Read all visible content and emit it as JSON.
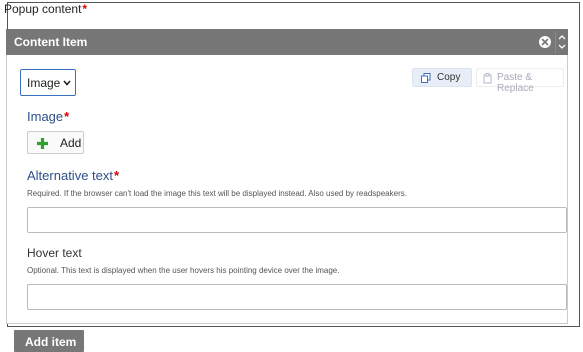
{
  "popup": {
    "label": "Popup content",
    "required_mark": "*"
  },
  "item_header": {
    "title": "Content Item"
  },
  "type_select": {
    "value": "Image"
  },
  "toolbar": {
    "copy_label": "Copy",
    "paste_label": "Paste & Replace"
  },
  "image_field": {
    "label": "Image",
    "required_mark": "*",
    "add_label": "Add"
  },
  "alt_text": {
    "label": "Alternative text",
    "required_mark": "*",
    "help": "Required. If the browser can't load the image this text will be displayed instead. Also used by readspeakers.",
    "value": ""
  },
  "hover_text": {
    "label": "Hover text",
    "help": "Optional. This text is displayed when the user hovers his pointing device over the image.",
    "value": ""
  },
  "footer": {
    "add_item_label": "Add item"
  },
  "colors": {
    "header_bg": "#777777",
    "accent": "#2d4f8a",
    "required": "#dd0000",
    "add_icon": "#2e9e2e"
  }
}
